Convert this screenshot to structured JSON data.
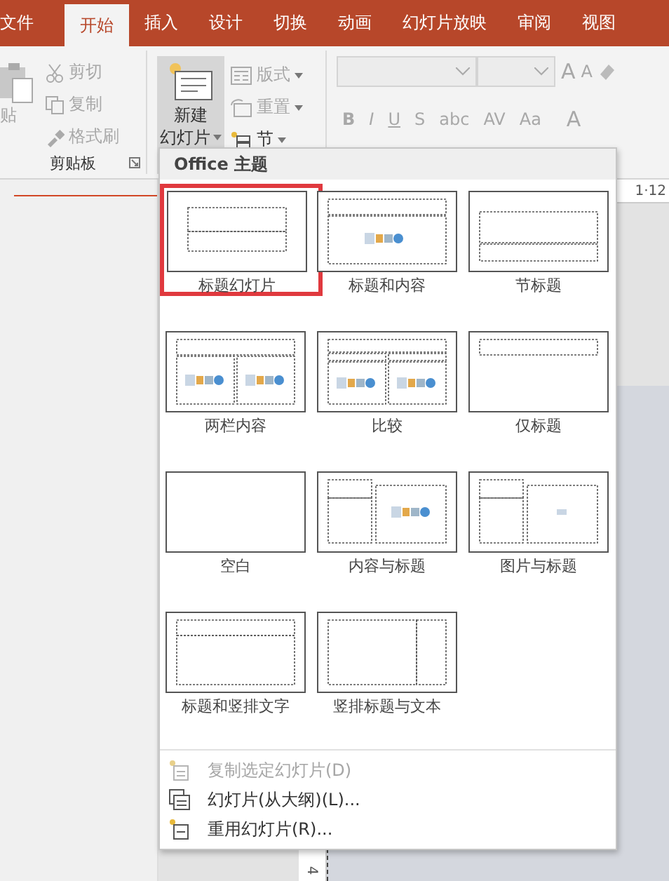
{
  "tabs": [
    {
      "label": "文件",
      "selected": false
    },
    {
      "label": "开始",
      "selected": true
    },
    {
      "label": "插入",
      "selected": false
    },
    {
      "label": "设计",
      "selected": false
    },
    {
      "label": "切换",
      "selected": false
    },
    {
      "label": "动画",
      "selected": false
    },
    {
      "label": "幻灯片放映",
      "selected": false
    },
    {
      "label": "审阅",
      "selected": false
    },
    {
      "label": "视图",
      "selected": false
    }
  ],
  "clipboard": {
    "paste": "贴",
    "items": [
      {
        "label": "剪切",
        "kind": "cut",
        "disabled": true
      },
      {
        "label": "复制",
        "kind": "copy",
        "disabled": true
      },
      {
        "label": "格式刷",
        "kind": "brush",
        "disabled": true
      }
    ],
    "group_label": "剪贴板"
  },
  "slides_group": {
    "new_slide": [
      "新建",
      "幻灯片"
    ],
    "items": [
      {
        "label": "版式",
        "kind": "layout",
        "disabled": true
      },
      {
        "label": "重置",
        "kind": "reset",
        "disabled": true
      },
      {
        "label": "节",
        "kind": "section",
        "disabled": false
      }
    ]
  },
  "font_group": {
    "format_buttons": [
      "B",
      "I",
      "U",
      "S",
      "abc",
      "AV",
      "Aa"
    ],
    "grow": "A",
    "shrink": "A",
    "font_color_label": "A"
  },
  "ruler_text": "1·12",
  "vertical_ruler_text": "4",
  "dropdown": {
    "header": "Office 主题",
    "layouts": [
      {
        "label": "标题幻灯片",
        "kind": "title",
        "selected": true
      },
      {
        "label": "标题和内容",
        "kind": "title_content",
        "selected": false
      },
      {
        "label": "节标题",
        "kind": "section",
        "selected": false
      },
      {
        "label": "两栏内容",
        "kind": "two_content",
        "selected": false
      },
      {
        "label": "比较",
        "kind": "comparison",
        "selected": false
      },
      {
        "label": "仅标题",
        "kind": "title_only",
        "selected": false
      },
      {
        "label": "空白",
        "kind": "blank",
        "selected": false
      },
      {
        "label": "内容与标题",
        "kind": "content_caption",
        "selected": false
      },
      {
        "label": "图片与标题",
        "kind": "picture_caption",
        "selected": false
      },
      {
        "label": "标题和竖排文字",
        "kind": "vertical_text",
        "selected": false
      },
      {
        "label": "竖排标题与文本",
        "kind": "vertical_title",
        "selected": false
      }
    ],
    "menu": [
      {
        "label": "复制选定幻灯片(D)",
        "kind": "duplicate",
        "disabled": true
      },
      {
        "label": "幻灯片(从大纲)(L)...",
        "kind": "outline",
        "disabled": false
      },
      {
        "label": "重用幻灯片(R)...",
        "kind": "reuse",
        "disabled": false
      }
    ]
  }
}
